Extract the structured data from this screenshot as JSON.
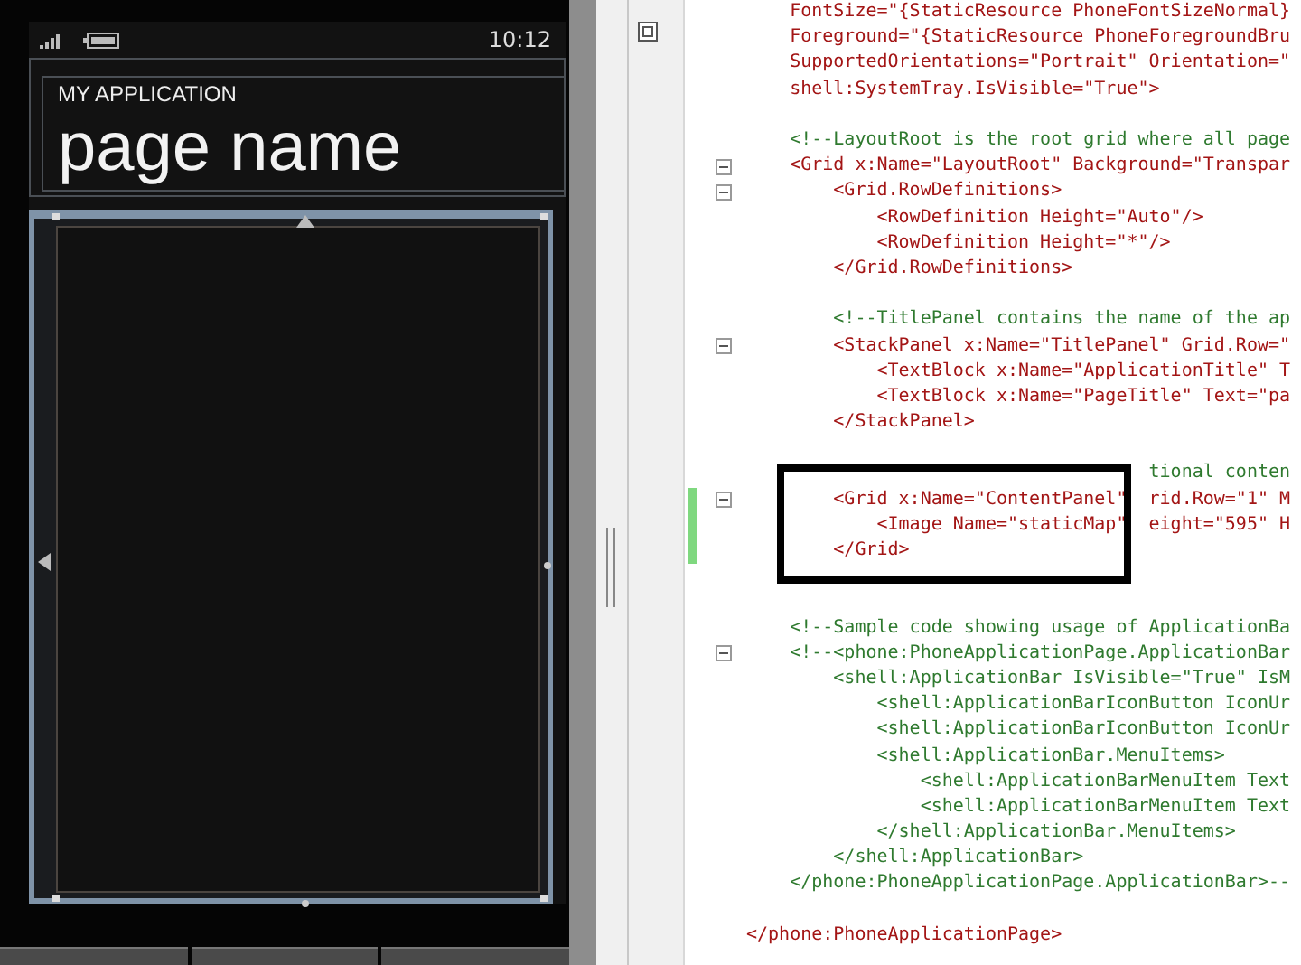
{
  "phone": {
    "status_time": "10:12",
    "app_title": "MY APPLICATION",
    "page_title": "page name"
  },
  "editor": {
    "lines": [
      {
        "text": "    FontSize=\"{StaticResource PhoneFontSizeNormal}",
        "kind": "code",
        "fold": false,
        "changed": false
      },
      {
        "text": "    Foreground=\"{StaticResource PhoneForegroundBru",
        "kind": "code",
        "fold": false,
        "changed": false
      },
      {
        "text": "    SupportedOrientations=\"Portrait\" Orientation=\"",
        "kind": "code",
        "fold": false,
        "changed": false
      },
      {
        "text": "    shell:SystemTray.IsVisible=\"True\">",
        "kind": "code",
        "fold": false,
        "changed": false
      },
      {
        "fold": false,
        "changed": false
      },
      {
        "text": "    <!--LayoutRoot is the root grid where all page",
        "kind": "comment",
        "fold": false,
        "changed": false
      },
      {
        "text": "    <Grid x:Name=\"LayoutRoot\" Background=\"Transpar",
        "kind": "code",
        "fold": true,
        "changed": false
      },
      {
        "text": "        <Grid.RowDefinitions>",
        "kind": "code",
        "fold": true,
        "changed": false
      },
      {
        "text": "            <RowDefinition Height=\"Auto\"/>",
        "kind": "code",
        "fold": false,
        "changed": false
      },
      {
        "text": "            <RowDefinition Height=\"*\"/>",
        "kind": "code",
        "fold": false,
        "changed": false
      },
      {
        "text": "        </Grid.RowDefinitions>",
        "kind": "code",
        "fold": false,
        "changed": false
      },
      {
        "fold": false,
        "changed": false
      },
      {
        "text": "        <!--TitlePanel contains the name of the ap",
        "kind": "comment",
        "fold": false,
        "changed": false
      },
      {
        "text": "        <StackPanel x:Name=\"TitlePanel\" Grid.Row=\"",
        "kind": "code",
        "fold": true,
        "changed": false
      },
      {
        "text": "            <TextBlock x:Name=\"ApplicationTitle\" T",
        "kind": "code",
        "fold": false,
        "changed": false
      },
      {
        "text": "            <TextBlock x:Name=\"PageTitle\" Text=\"pa",
        "kind": "code",
        "fold": false,
        "changed": false
      },
      {
        "text": "        </StackPanel>",
        "kind": "code",
        "fold": false,
        "changed": false
      },
      {
        "fold": false,
        "changed": false
      },
      {
        "text": "                                     tional conten",
        "kind": "comment",
        "fold": false,
        "changed": false
      },
      {
        "text": "        <Grid x:Name=\"ContentPanel\"  rid.Row=\"1\" M",
        "kind": "code",
        "fold": true,
        "changed": true
      },
      {
        "text": "            <Image Name=\"staticMap\"  eight=\"595\" H",
        "kind": "code",
        "fold": false,
        "changed": true
      },
      {
        "text": "        </Grid>",
        "kind": "code",
        "fold": false,
        "changed": true
      },
      {
        "fold": false,
        "changed": false
      },
      {
        "fold": false,
        "changed": false
      },
      {
        "text": "    <!--Sample code showing usage of ApplicationBa",
        "kind": "comment",
        "fold": false,
        "changed": false
      },
      {
        "text": "    <!--<phone:PhoneApplicationPage.ApplicationBar",
        "kind": "comment",
        "fold": true,
        "changed": false
      },
      {
        "text": "        <shell:ApplicationBar IsVisible=\"True\" IsM",
        "kind": "comment",
        "fold": false,
        "changed": false
      },
      {
        "text": "            <shell:ApplicationBarIconButton IconUr",
        "kind": "comment",
        "fold": false,
        "changed": false
      },
      {
        "text": "            <shell:ApplicationBarIconButton IconUr",
        "kind": "comment",
        "fold": false,
        "changed": false
      },
      {
        "text": "            <shell:ApplicationBar.MenuItems>",
        "kind": "comment",
        "fold": false,
        "changed": false
      },
      {
        "text": "                <shell:ApplicationBarMenuItem Text",
        "kind": "comment",
        "fold": false,
        "changed": false
      },
      {
        "text": "                <shell:ApplicationBarMenuItem Text",
        "kind": "comment",
        "fold": false,
        "changed": false
      },
      {
        "text": "            </shell:ApplicationBar.MenuItems>",
        "kind": "comment",
        "fold": false,
        "changed": false
      },
      {
        "text": "        </shell:ApplicationBar>",
        "kind": "comment",
        "fold": false,
        "changed": false
      },
      {
        "text": "    </phone:PhoneApplicationPage.ApplicationBar>--",
        "kind": "comment",
        "fold": false,
        "changed": false
      },
      {
        "fold": false,
        "changed": false
      },
      {
        "text": "</phone:PhoneApplicationPage>",
        "kind": "code",
        "fold": false,
        "changed": false
      }
    ]
  }
}
